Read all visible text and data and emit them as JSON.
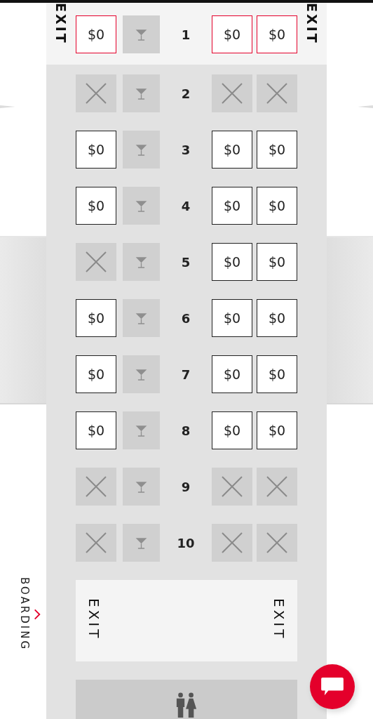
{
  "rows": [
    {
      "number": "1",
      "exit_row": true,
      "exit_labels": [
        "EXIT",
        "EXIT"
      ],
      "seats": [
        {
          "available": true,
          "price": "$0"
        },
        {
          "available": true,
          "price": "$0"
        },
        {
          "available": true,
          "price": "$0"
        }
      ]
    },
    {
      "number": "2",
      "exit_row": false,
      "seats": [
        {
          "available": false
        },
        {
          "available": false
        },
        {
          "available": false
        }
      ]
    },
    {
      "number": "3",
      "exit_row": false,
      "seats": [
        {
          "available": true,
          "price": "$0"
        },
        {
          "available": true,
          "price": "$0"
        },
        {
          "available": true,
          "price": "$0"
        }
      ]
    },
    {
      "number": "4",
      "exit_row": false,
      "seats": [
        {
          "available": true,
          "price": "$0"
        },
        {
          "available": true,
          "price": "$0"
        },
        {
          "available": true,
          "price": "$0"
        }
      ]
    },
    {
      "number": "5",
      "exit_row": false,
      "seats": [
        {
          "available": false
        },
        {
          "available": true,
          "price": "$0"
        },
        {
          "available": true,
          "price": "$0"
        }
      ]
    },
    {
      "number": "6",
      "exit_row": false,
      "seats": [
        {
          "available": true,
          "price": "$0"
        },
        {
          "available": true,
          "price": "$0"
        },
        {
          "available": true,
          "price": "$0"
        }
      ]
    },
    {
      "number": "7",
      "exit_row": false,
      "seats": [
        {
          "available": true,
          "price": "$0"
        },
        {
          "available": true,
          "price": "$0"
        },
        {
          "available": true,
          "price": "$0"
        }
      ]
    },
    {
      "number": "8",
      "exit_row": false,
      "seats": [
        {
          "available": true,
          "price": "$0"
        },
        {
          "available": true,
          "price": "$0"
        },
        {
          "available": true,
          "price": "$0"
        }
      ]
    },
    {
      "number": "9",
      "exit_row": false,
      "seats": [
        {
          "available": false
        },
        {
          "available": false
        },
        {
          "available": false
        }
      ]
    },
    {
      "number": "10",
      "exit_row": false,
      "seats": [
        {
          "available": false
        },
        {
          "available": false
        },
        {
          "available": false
        }
      ]
    }
  ],
  "exit_area": {
    "labels": [
      "EXIT",
      "EXIT"
    ]
  },
  "boarding": {
    "label": "BOARDING"
  }
}
